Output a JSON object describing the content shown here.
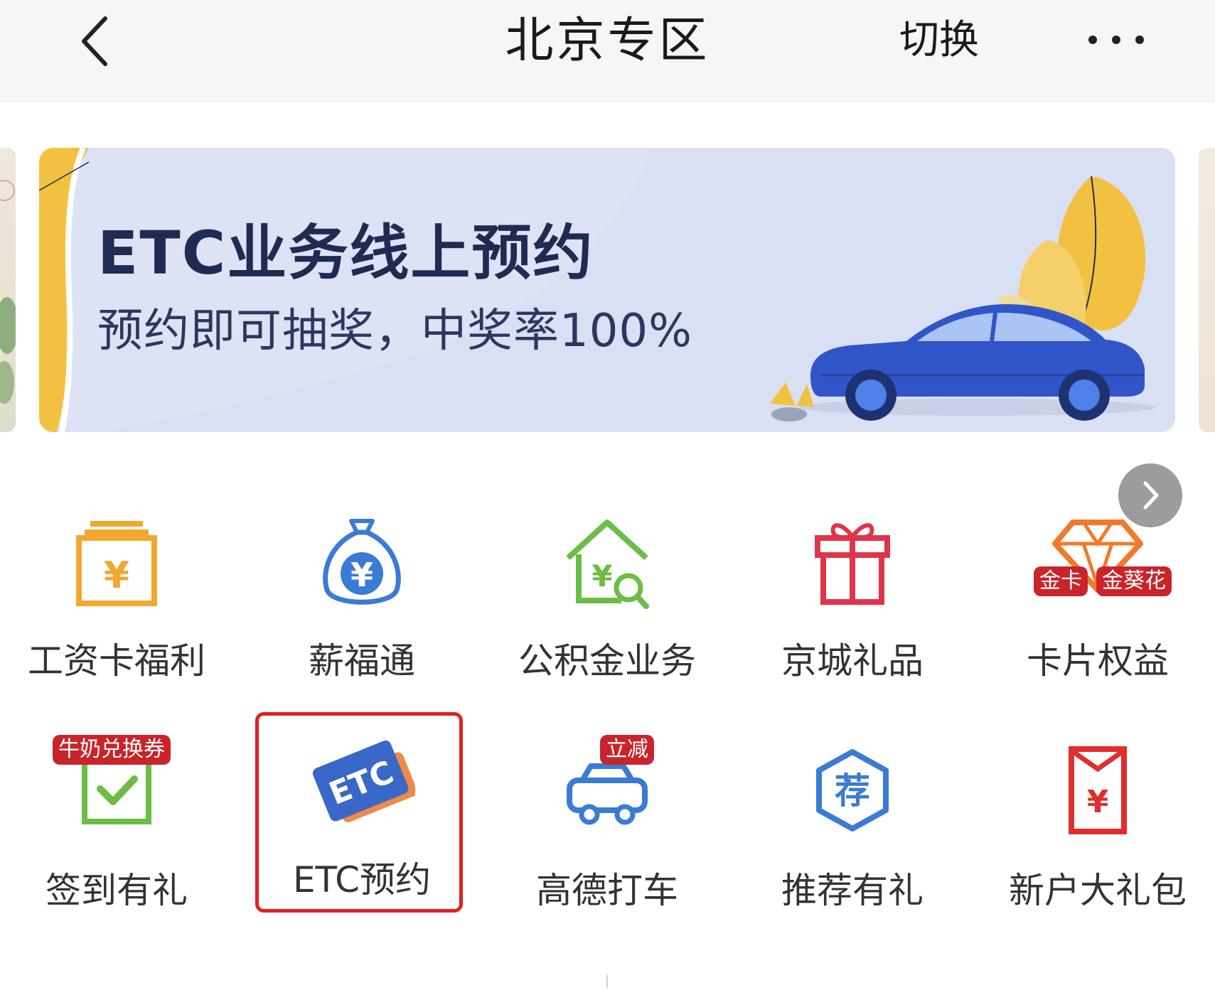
{
  "nav": {
    "title": "北京专区",
    "switch_label": "切换",
    "back_icon": "chevron-left-icon",
    "more_icon": "more-dots-icon"
  },
  "banner": {
    "title": "ETC业务线上预约",
    "subtitle": "预约即可抽奖，中奖率100%",
    "colors": {
      "background": "#dde3f5",
      "car": "#2f55c8",
      "leaf": "#f3c142",
      "title": "#1f2b52"
    }
  },
  "grid": {
    "next_icon": "chevron-right-icon",
    "items": [
      {
        "label": "工资卡福利",
        "icon": "salary-card-icon"
      },
      {
        "label": "薪福通",
        "icon": "money-bag-icon"
      },
      {
        "label": "公积金业务",
        "icon": "housing-fund-icon"
      },
      {
        "label": "京城礼品",
        "icon": "gift-box-icon"
      },
      {
        "label": "卡片权益",
        "icon": "diamond-icon",
        "badges": [
          "金卡",
          "金葵花"
        ]
      },
      {
        "label": "签到有礼",
        "icon": "checkin-icon",
        "badges": [
          "牛奶兑换券"
        ]
      },
      {
        "label": "ETC预约",
        "icon": "etc-card-icon",
        "icon_text": "ETC",
        "highlighted": true
      },
      {
        "label": "高德打车",
        "icon": "taxi-car-icon",
        "badges": [
          "立减"
        ]
      },
      {
        "label": "推荐有礼",
        "icon": "recommend-icon",
        "icon_text": "荐"
      },
      {
        "label": "新户大礼包",
        "icon": "red-envelope-icon"
      }
    ]
  }
}
